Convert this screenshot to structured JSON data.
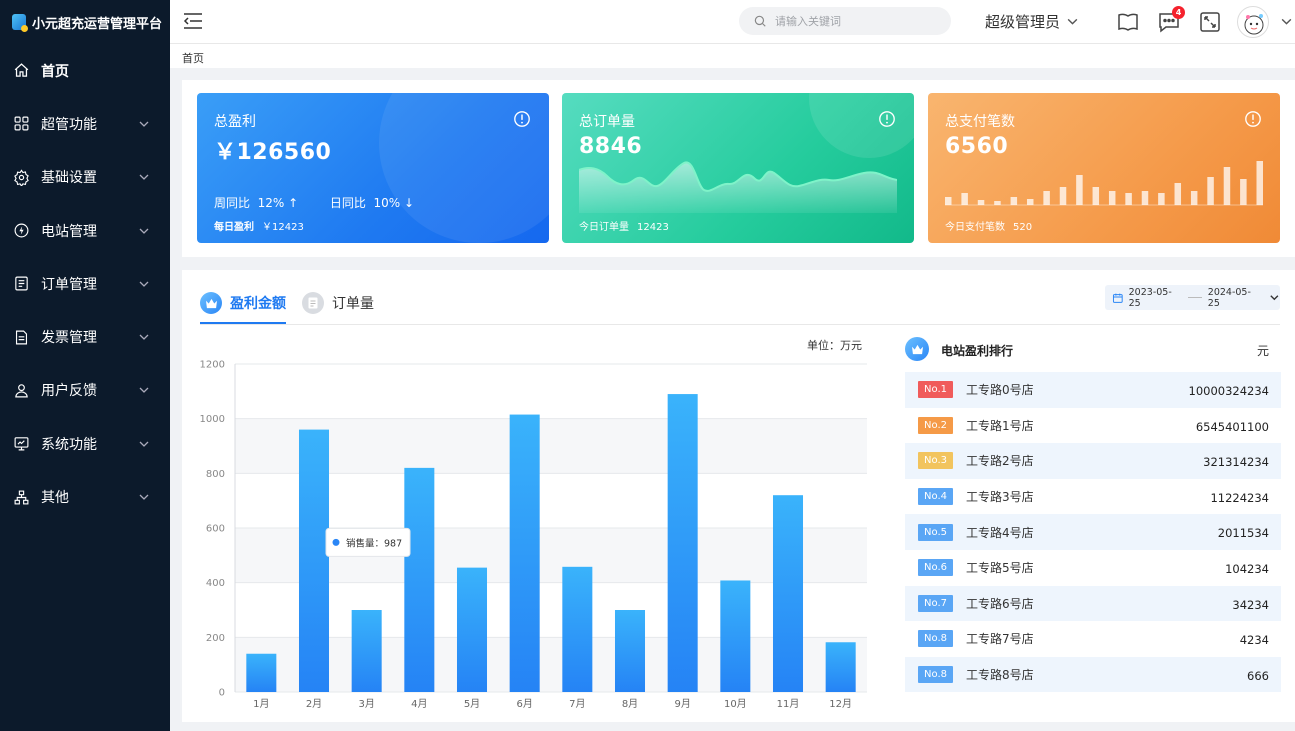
{
  "app": {
    "title": "小元超充运营管理平台"
  },
  "sidebar": {
    "items": [
      {
        "label": "首页",
        "icon": "home-icon"
      },
      {
        "label": "超管功能",
        "icon": "grid-icon"
      },
      {
        "label": "基础设置",
        "icon": "gear-icon"
      },
      {
        "label": "电站管理",
        "icon": "station-icon"
      },
      {
        "label": "订单管理",
        "icon": "order-icon"
      },
      {
        "label": "发票管理",
        "icon": "invoice-icon"
      },
      {
        "label": "用户反馈",
        "icon": "user-icon"
      },
      {
        "label": "系统功能",
        "icon": "monitor-icon"
      },
      {
        "label": "其他",
        "icon": "sitemap-icon"
      }
    ]
  },
  "header": {
    "search_placeholder": "请输入关键词",
    "user": "超级管理员",
    "notification_count": "4"
  },
  "breadcrumb": "首页",
  "stats": {
    "profit": {
      "title": "总盈利",
      "value": "￥126560",
      "week_label": "周同比",
      "week_val": "12% ↑",
      "day_label": "日同比",
      "day_val": "10% ↓",
      "foot_label": "每日盈利",
      "foot_val": "￥12423"
    },
    "orders": {
      "title": "总订单量",
      "value": "8846",
      "foot_label": "今日订单量",
      "foot_val": "12423"
    },
    "payments": {
      "title": "总支付笔数",
      "value": "6560",
      "foot_label": "今日支付笔数",
      "foot_val": "520"
    }
  },
  "tabs": [
    {
      "label": "盈利金额",
      "active": true
    },
    {
      "label": "订单量",
      "active": false
    }
  ],
  "date_range": {
    "start": "2023-05-25",
    "end": "2024-05-25"
  },
  "chart_unit": "单位：万元",
  "chart_data": {
    "type": "bar",
    "categories": [
      "1月",
      "2月",
      "3月",
      "4月",
      "5月",
      "6月",
      "7月",
      "8月",
      "9月",
      "10月",
      "11月",
      "12月"
    ],
    "values": [
      140,
      960,
      300,
      820,
      455,
      1015,
      458,
      300,
      1090,
      408,
      720,
      182
    ],
    "ylim": [
      0,
      1200
    ],
    "yticks": [
      0,
      200,
      400,
      600,
      800,
      1000,
      1200
    ],
    "tooltip": {
      "label": "销售量：",
      "value": "987",
      "category_index": 1
    },
    "color": "#2f8ef8"
  },
  "ranking": {
    "title": "电站盈利排行",
    "unit": "元",
    "rows": [
      {
        "rank": "No.1",
        "name": "工专路0号店",
        "value": "10000324234",
        "color": "#f05b5b"
      },
      {
        "rank": "No.2",
        "name": "工专路1号店",
        "value": "6545401100",
        "color": "#f59a47"
      },
      {
        "rank": "No.3",
        "name": "工专路2号店",
        "value": "321314234",
        "color": "#f2c45e"
      },
      {
        "rank": "No.4",
        "name": "工专路3号店",
        "value": "11224234",
        "color": "#5aa6f5"
      },
      {
        "rank": "No.5",
        "name": "工专路4号店",
        "value": "2011534",
        "color": "#5aa6f5"
      },
      {
        "rank": "No.6",
        "name": "工专路5号店",
        "value": "104234",
        "color": "#5aa6f5"
      },
      {
        "rank": "No.7",
        "name": "工专路6号店",
        "value": "34234",
        "color": "#5aa6f5"
      },
      {
        "rank": "No.8",
        "name": "工专路7号店",
        "value": "4234",
        "color": "#5aa6f5"
      },
      {
        "rank": "No.8",
        "name": "工专路8号店",
        "value": "666",
        "color": "#5aa6f5"
      }
    ]
  }
}
